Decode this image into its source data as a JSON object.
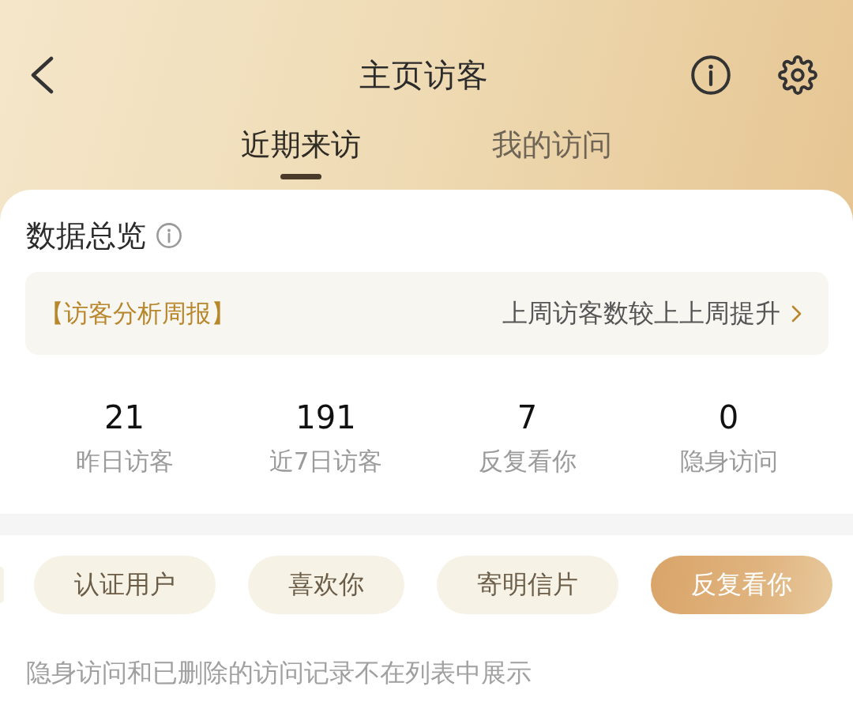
{
  "header": {
    "title": "主页访客"
  },
  "tabs": [
    {
      "label": "近期来访",
      "selected": true
    },
    {
      "label": "我的访问",
      "selected": false
    }
  ],
  "overview": {
    "title": "数据总览",
    "report": {
      "tag": "【访客分析周报】",
      "summary": "上周访客数较上上周提升"
    },
    "stats": [
      {
        "value": "21",
        "label": "昨日访客"
      },
      {
        "value": "191",
        "label": "近7日访客"
      },
      {
        "value": "7",
        "label": "反复看你"
      },
      {
        "value": "0",
        "label": "隐身访问"
      }
    ]
  },
  "filters": [
    {
      "label": "认证用户",
      "selected": false
    },
    {
      "label": "喜欢你",
      "selected": false
    },
    {
      "label": "寄明信片",
      "selected": false
    },
    {
      "label": "反复看你",
      "selected": true
    }
  ],
  "note": "隐身访问和已删除的访问记录不在列表中展示"
}
